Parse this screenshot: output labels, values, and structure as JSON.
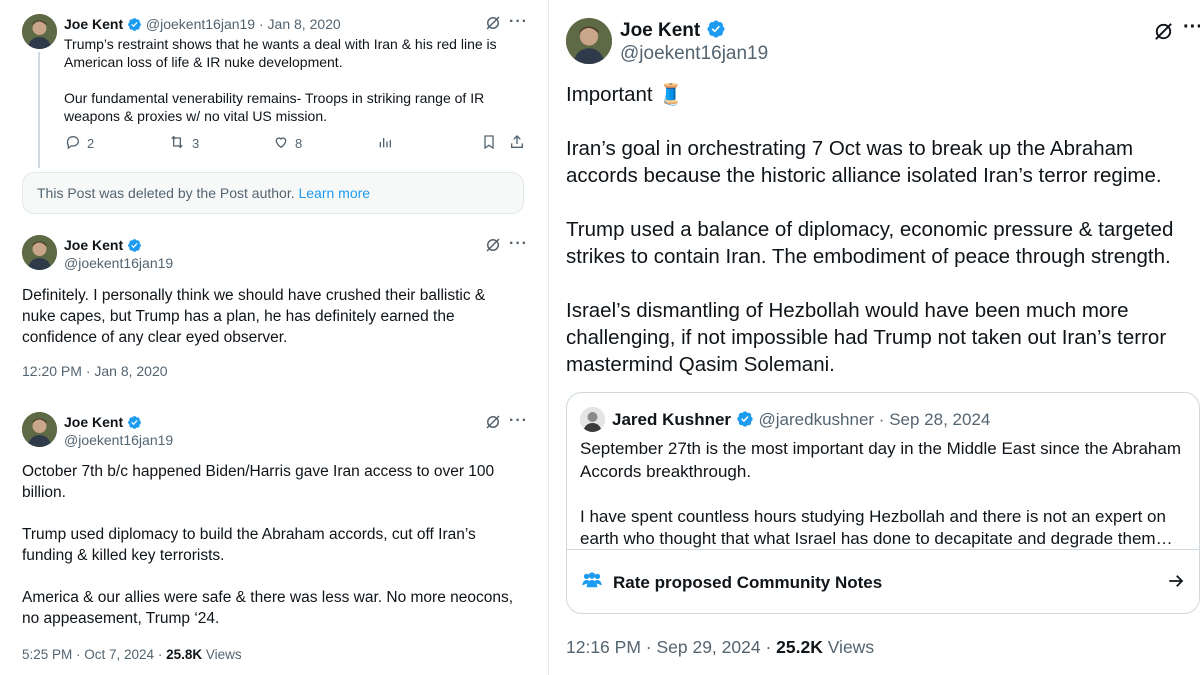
{
  "colors": {
    "accent": "#1d9bf0",
    "text": "#0f1419",
    "muted": "#536471",
    "border": "#cfd9de"
  },
  "left": {
    "tweet1": {
      "name": "Joe Kent",
      "handle": "@joekent16jan19",
      "dot": "·",
      "date": "Jan 8, 2020",
      "text": "Trump’s restraint shows that he wants a deal with Iran & his red line is American loss of life & IR nuke development.\n\nOur fundamental venerability remains- Troops in striking range of IR weapons & proxies w/ no vital US mission.",
      "replies": "2",
      "reposts": "3",
      "likes": "8"
    },
    "deleted": {
      "text": "This Post was deleted by the Post author.",
      "link": "Learn more"
    },
    "tweet2": {
      "name": "Joe Kent",
      "handle": "@joekent16jan19",
      "text": "Definitely. I personally think we should have crushed their ballistic & nuke capes, but Trump has a plan, he has definitely earned the confidence of any clear eyed observer.",
      "timestamp": "12:20 PM · Jan 8, 2020"
    },
    "tweet3": {
      "name": "Joe Kent",
      "handle": "@joekent16jan19",
      "text": "October 7th b/c happened Biden/Harris gave Iran access to over 100 billion.\n\nTrump used diplomacy to build the Abraham accords, cut off Iran’s funding & killed key terrorists.\n\nAmerica & our allies were safe & there was less war. No more neocons, no appeasement, Trump ‘24.",
      "timestamp": "5:25 PM · Oct 7, 2024 · ",
      "views_count": "25.8K",
      "views_label": " Views"
    }
  },
  "right": {
    "name": "Joe Kent",
    "handle": "@joekent16jan19",
    "text": "Important 🧵\n\nIran’s goal in orchestrating 7 Oct was to break up the Abraham accords because the historic alliance isolated Iran’s terror regime.\n\nTrump used a balance of diplomacy, economic pressure & targeted strikes to contain Iran. The embodiment of peace through strength.\n\nIsrael’s dismantling of Hezbollah would have been much more challenging, if not impossible had Trump not taken out Iran’s terror mastermind Qasim Solemani.",
    "quote": {
      "name": "Jared Kushner",
      "handle": "@jaredkushner",
      "dot": "·",
      "date": "Sep 28, 2024",
      "text": "September 27th is the most important day in the Middle East since the Abraham Accords breakthrough.\n\nI have spent countless hours studying Hezbollah and there is not an expert on earth who thought that what Israel has done to decapitate and degrade them…"
    },
    "community_notes": "Rate proposed Community Notes",
    "timestamp": "12:16 PM · Sep 29, 2024 · ",
    "views_count": "25.2K",
    "views_label": " Views"
  }
}
